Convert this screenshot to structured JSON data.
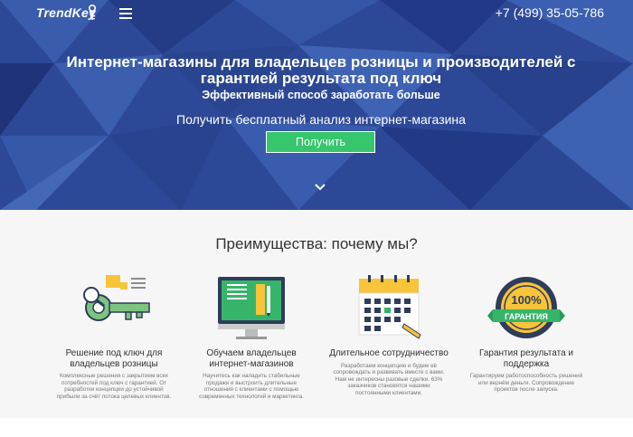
{
  "header": {
    "logo": "TrendKey",
    "phone": "+7 (499) 35-05-786"
  },
  "hero": {
    "title": "Интернет-магазины для владельцев розницы и производителей с гарантией результата под ключ",
    "subtitle": "Эффективный способ заработать больше",
    "cta_text": "Получить бесплатный анализ интернет-магазина",
    "cta_button": "Получить"
  },
  "advantages": {
    "title": "Преимущества: почему мы?",
    "items": [
      {
        "icon": "key-icon",
        "title": "Решение под ключ для владельцев розницы",
        "desc": "Комплексные решения с закрытием всех потребностей под ключ с гарантией. От разработки концепции до устойчивой прибыли за счёт потока целевых клиентов."
      },
      {
        "icon": "monitor-icon",
        "title": "Обучаем владельцев интернет-магазинов",
        "desc": "Научитесь как наладить стабильные продажи и выстроить длительные отношения с клиентами с помощью современных технологий и маркетинга."
      },
      {
        "icon": "calendar-icon",
        "title": "Длительное сотрудничество",
        "desc": "Разработаем концепцию и будем её сопровождать и развивать вместе с вами. Нам не интересны разовые сделки. 63% заказчиков становятся нашими постоянными клиентами."
      },
      {
        "icon": "guarantee-badge-icon",
        "title": "Гарантия результата и поддержка",
        "desc": "Гарантируем работоспособность решений или вернём деньги. Сопровождение проектов после запуска.",
        "badge_percent": "100%",
        "badge_label": "ГАРАНТИЯ"
      }
    ]
  },
  "colors": {
    "hero_blue": "#2e4a9c",
    "accent_green": "#36c66d",
    "key_green": "#7cc47f",
    "badge_navy": "#2e3d5b",
    "badge_yellow": "#f7c43a"
  }
}
